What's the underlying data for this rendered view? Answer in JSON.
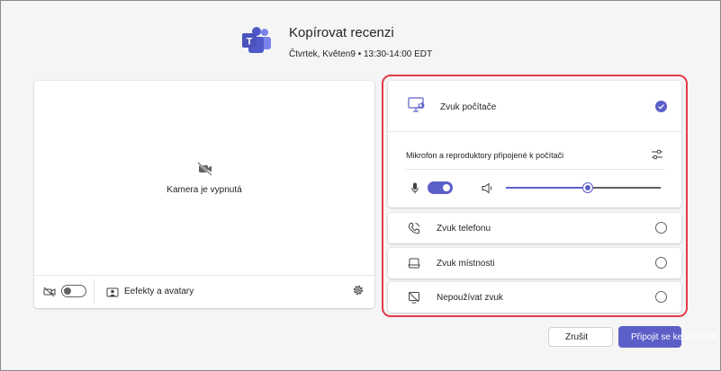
{
  "header": {
    "title": "Kopírovat recenzi",
    "subtitle": "Čtvrtek, Květen9 • 13:30-14:00 EDT",
    "logo_icon": "teams-logo-icon"
  },
  "preview": {
    "camera_off_label": "Kamera je vypnutá",
    "effects_label": "Eefekty a avatary",
    "camera_toggle_on": false
  },
  "audio": {
    "computer_audio": {
      "label": "Zvuk počítače",
      "selected": true,
      "devices_label": "Mikrofon a reproduktory připojené k počítači",
      "mic_on": true,
      "volume_fraction": 0.53
    },
    "options": [
      {
        "label": "Zvuk telefonu",
        "icon": "phone-icon",
        "selected": false
      },
      {
        "label": "Zvuk místnosti",
        "icon": "room-display-icon",
        "selected": false
      },
      {
        "label": "Nepoužívat zvuk",
        "icon": "no-audio-icon",
        "selected": false
      }
    ]
  },
  "actions": {
    "cancel_label": "Zrušit",
    "join_label": "Připojit se ke skupině"
  },
  "colors": {
    "accent": "#5b5fc7",
    "highlight_border": "#e23c4a"
  }
}
